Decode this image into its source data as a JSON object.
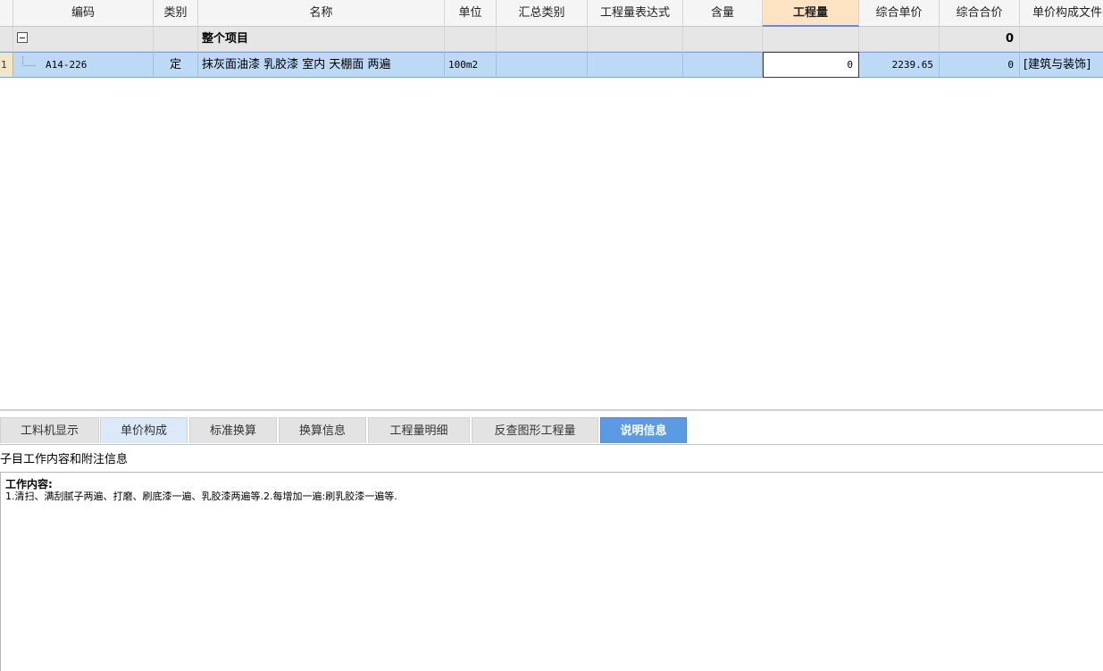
{
  "columns": [
    "编码",
    "类别",
    "名称",
    "单位",
    "汇总类别",
    "工程量表达式",
    "含量",
    "工程量",
    "综合单价",
    "综合合价",
    "单价构成文件"
  ],
  "active_column": "工程量",
  "rows": [
    {
      "row_number": "",
      "code": "",
      "category": "",
      "name": "整个项目",
      "unit": "",
      "summary_category": "",
      "quantity_expression": "",
      "content": "",
      "quantity": "",
      "unit_price": "",
      "total_price": "0",
      "price_file": ""
    },
    {
      "row_number": "1",
      "code": "A14-226",
      "category": "定",
      "name": "抹灰面油漆 乳胶漆 室内 天棚面 两遍",
      "unit": "100m2",
      "summary_category": "",
      "quantity_expression": "",
      "content": "",
      "quantity": "0",
      "unit_price": "2239.65",
      "total_price": "0",
      "price_file": "[建筑与装饰]"
    }
  ],
  "tabs": [
    "工料机显示",
    "单价构成",
    "标准换算",
    "换算信息",
    "工程量明细",
    "反查图形工程量",
    "说明信息"
  ],
  "selected_tab": "说明信息",
  "info": {
    "section_title": "子目工作内容和附注信息",
    "heading": "工作内容:",
    "body": "1.清扫、满刮腻子两遍、打磨、刷底漆一遍、乳胶漆两遍等.2.每增加一遍:刷乳胶漆一遍等."
  },
  "colors": {
    "selected_row": "#bcd9f6",
    "active_header": "#fde3c1",
    "selected_tab": "#5b9be6"
  },
  "icons": {
    "collapse": "minus-box-icon",
    "tree_connector": "tree-line-icon"
  }
}
